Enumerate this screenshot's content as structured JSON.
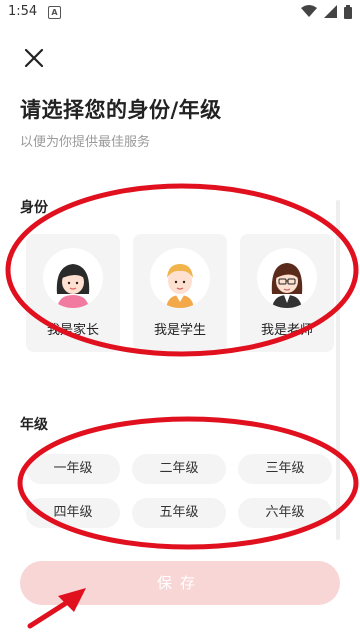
{
  "status_bar": {
    "time": "1:54",
    "app_icon_letter": "A",
    "icons": [
      "wifi-icon",
      "signal-icon",
      "battery-icon"
    ]
  },
  "header": {
    "close_icon": "close-icon",
    "title": "请选择您的身份/年级",
    "subtitle": "以便为你提供最佳服务"
  },
  "identity": {
    "label": "身份",
    "options": [
      {
        "label": "我是家长",
        "icon": "parent-avatar-icon"
      },
      {
        "label": "我是学生",
        "icon": "student-avatar-icon"
      },
      {
        "label": "我是老师",
        "icon": "teacher-avatar-icon"
      }
    ]
  },
  "grade": {
    "label": "年级",
    "options": [
      "一年级",
      "二年级",
      "三年级",
      "四年级",
      "五年级",
      "六年级"
    ]
  },
  "footer": {
    "save_label": "保存"
  },
  "colors": {
    "save_button_bg": "#f9d6d6",
    "annotation_red": "#e0101e",
    "card_bg": "#f4f4f4"
  }
}
